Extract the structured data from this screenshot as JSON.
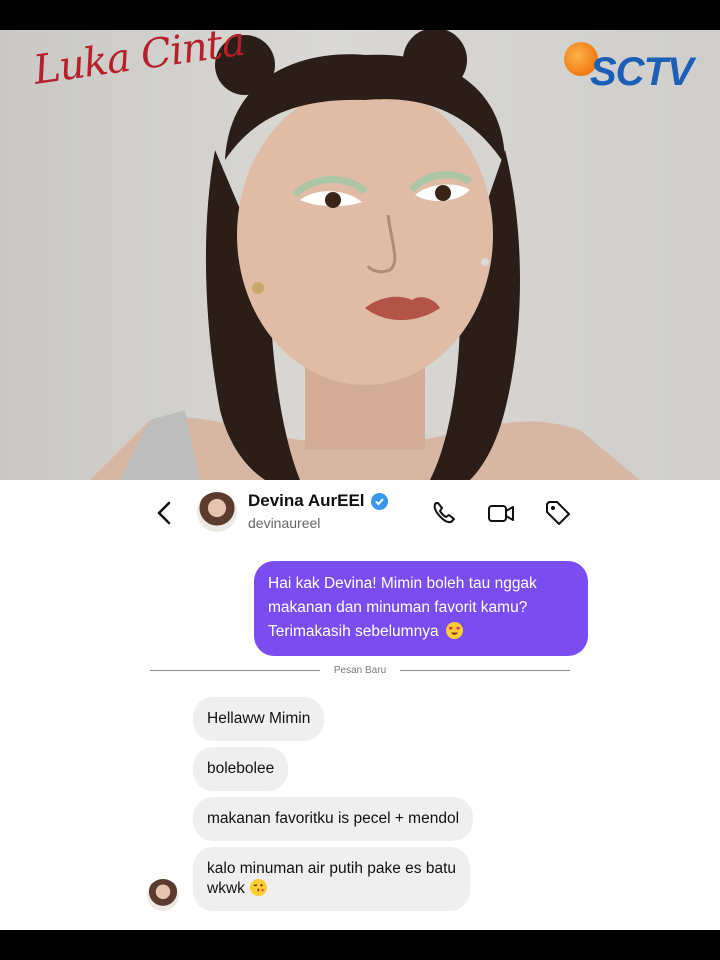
{
  "overlay": {
    "show_title": "Luka Cinta",
    "channel": "SCTV"
  },
  "header": {
    "name": "Devina AurEEl",
    "handle": "devinaureel",
    "icons": [
      "back-icon",
      "verified-badge-icon",
      "phone-icon",
      "video-call-icon",
      "tag-icon"
    ]
  },
  "messages": {
    "outgoing_line1": "Hai kak Devina! Mimin boleh tau nggak",
    "outgoing_line2": "makanan dan minuman favorit kamu?",
    "outgoing_line3": "Terimakasih sebelumnya",
    "divider_label": "Pesan Baru",
    "reply1": "Hellaww Mimin",
    "reply2": "bolebolee",
    "reply3": "makanan favoritku is pecel + mendol",
    "reply4_line1": "kalo minuman air putih pake es batu",
    "reply4_line2": "wkwk"
  },
  "colors": {
    "outgoing_bubble": "#7b4cf0",
    "incoming_bubble": "#efefef",
    "verified": "#3897f0",
    "show_title": "#b5202a",
    "channel_blue": "#1b5fb6",
    "channel_orange": "#f07a12"
  }
}
